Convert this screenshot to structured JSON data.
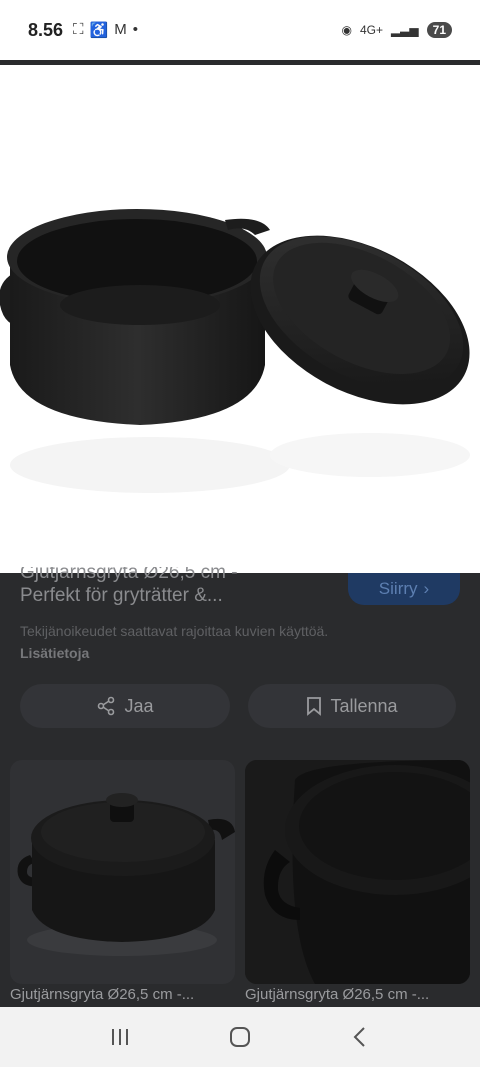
{
  "status_bar": {
    "time": "8.56",
    "battery": "71",
    "network": "4G+"
  },
  "result": {
    "title_line1_partial": "Gjutjärnsgryta Ø26,5 cm -",
    "title_line2": "Perfekt för gryträtter &...",
    "visit_label": "Siirry",
    "copyright_text": "Tekijänoikeudet saattavat rajoittaa kuvien käyttöä.",
    "more_info_label": "Lisätietoja"
  },
  "actions": {
    "share_label": "Jaa",
    "save_label": "Tallenna"
  },
  "related": [
    {
      "caption": "Gjutjärnsgryta Ø26,5 cm -..."
    },
    {
      "caption": "Gjutjärnsgryta Ø26,5 cm -..."
    }
  ],
  "icons": {
    "share": "share-icon",
    "bookmark": "bookmark-icon",
    "chevron": "chevron-right-icon",
    "nav_recent": "recent-apps-icon",
    "nav_home": "home-icon",
    "nav_back": "back-icon"
  }
}
